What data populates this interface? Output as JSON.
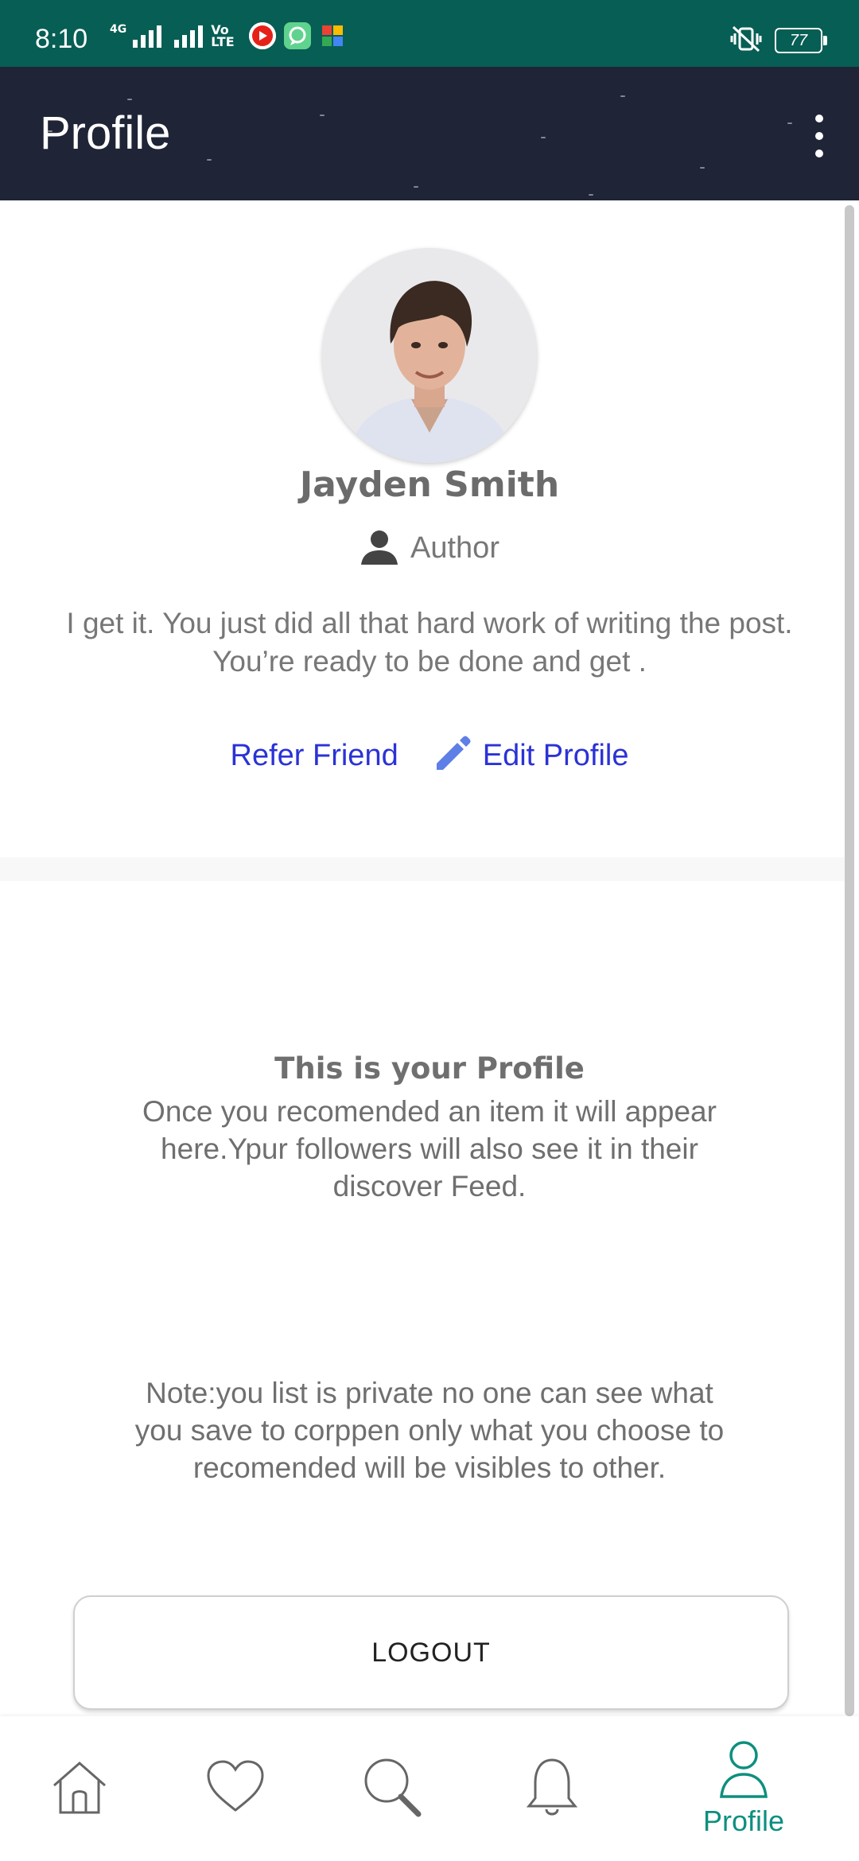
{
  "status_bar": {
    "time": "8:10",
    "network_label": "4G",
    "volte_label": "Vo LTE",
    "battery": "77",
    "color": "#075e54"
  },
  "app_bar": {
    "title": "Profile",
    "color": "#1f2536"
  },
  "profile": {
    "name": "Jayden Smith",
    "role": "Author",
    "bio": "I get it. You just did all that hard work of writing the post. You’re ready to be done and get .",
    "refer_label": "Refer Friend",
    "edit_label": "Edit Profile",
    "link_color": "#2b32d6"
  },
  "empty_state": {
    "title": "This is your Profile",
    "description": "Once you recomended an item  it will appear here.Ypur followers will also see it in their discover Feed."
  },
  "note": "Note:you list is private no one can see what you  save to corppen only what you choose to recomended will be visibles to other.",
  "logout_label": "LOGOUT",
  "bottom_nav": {
    "items": [
      {
        "icon": "home-icon"
      },
      {
        "icon": "heart-icon"
      },
      {
        "icon": "search-icon"
      },
      {
        "icon": "bell-icon"
      },
      {
        "icon": "person-icon",
        "label": "Profile",
        "active": true
      }
    ],
    "active_color": "#0d8f7f"
  }
}
